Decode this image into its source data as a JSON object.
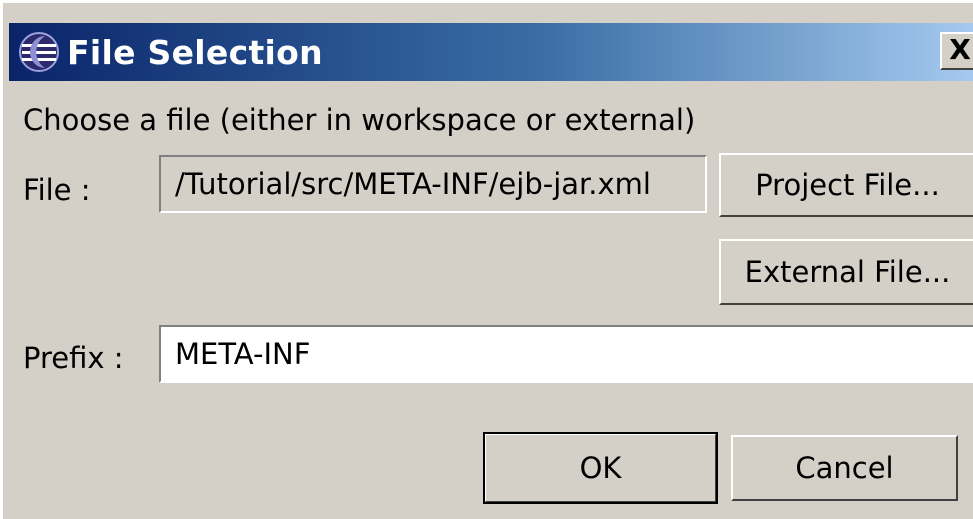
{
  "window": {
    "title": "File Selection",
    "close_label": "X",
    "icon": "eclipse-icon"
  },
  "instruction": "Choose a file (either in workspace or external)",
  "file": {
    "label": "File :",
    "value": "/Tutorial/src/META-INF/ejb-jar.xml"
  },
  "buttons": {
    "project_file": "Project File...",
    "external_file": "External File...",
    "ok": "OK",
    "cancel": "Cancel"
  },
  "prefix": {
    "label": "Prefix :",
    "value": "META-INF"
  },
  "colors": {
    "titlebar_start": "#0a246a",
    "titlebar_end": "#a6caf0",
    "dialog_bg": "#d4d0c8"
  }
}
